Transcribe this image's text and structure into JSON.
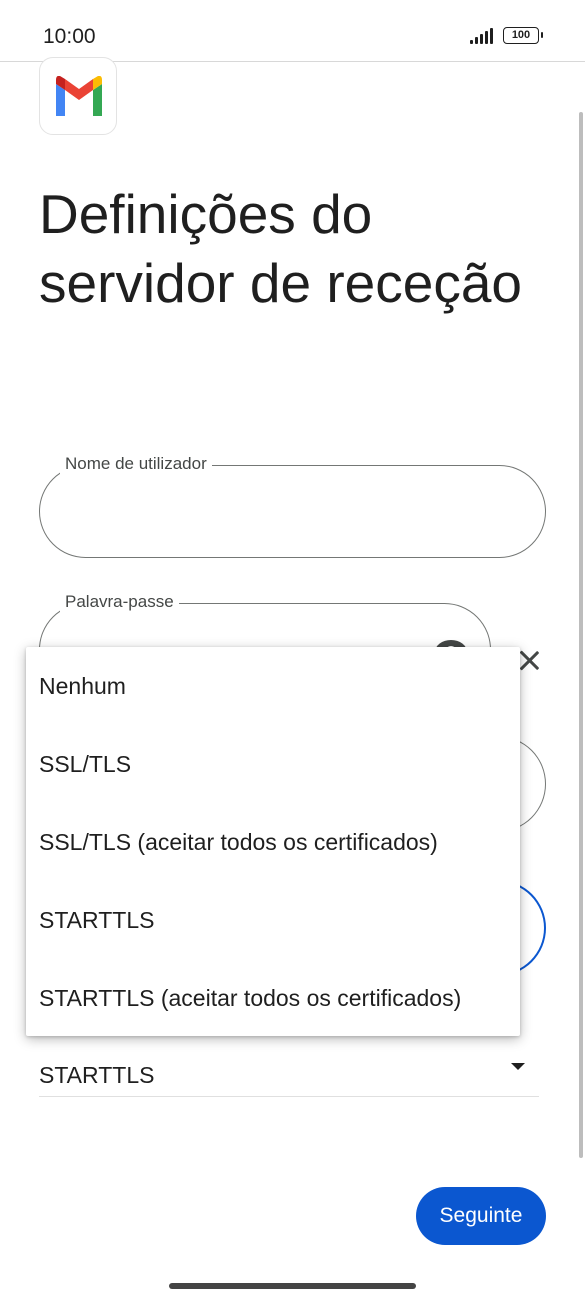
{
  "status_bar": {
    "time": "10:00",
    "battery": "100"
  },
  "page": {
    "title": "Definições do servidor de receção"
  },
  "form": {
    "username_label": "Nome de utilizador",
    "password_label": "Palavra-passe",
    "security_type_value": "STARTTLS"
  },
  "dropdown": {
    "options": [
      "Nenhum",
      "SSL/TLS",
      "SSL/TLS (aceitar todos os certificados)",
      "STARTTLS",
      "STARTTLS (aceitar todos os certificados)"
    ]
  },
  "actions": {
    "next_label": "Seguinte"
  },
  "colors": {
    "accent": "#0b57d0",
    "text": "#1f1f1f",
    "outline": "#747775"
  },
  "icons": [
    "gmail-logo-icon",
    "eye-icon",
    "close-icon",
    "dropdown-arrow-icon",
    "signal-icon",
    "battery-icon"
  ]
}
